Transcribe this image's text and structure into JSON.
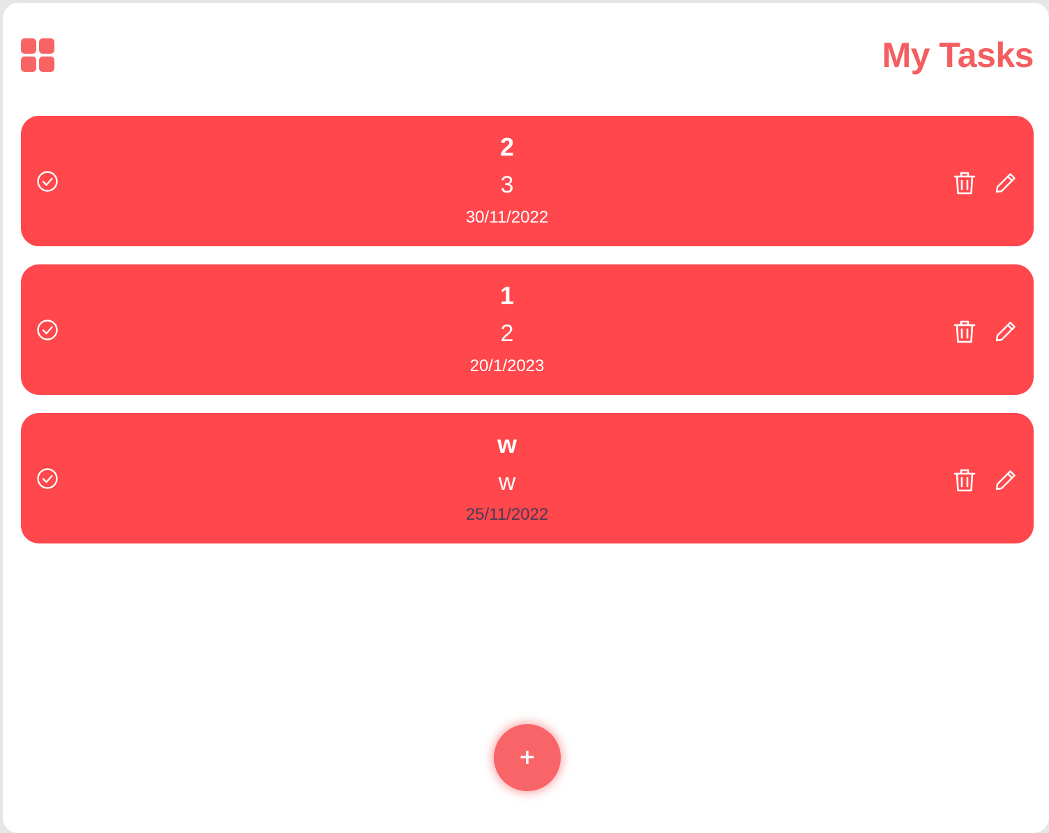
{
  "header": {
    "title": "My Tasks",
    "menu_icon": "grid-icon"
  },
  "tasks": [
    {
      "title": "2",
      "description": "3",
      "date": "30/11/2022",
      "date_color": "#ffffff"
    },
    {
      "title": "1",
      "description": "2",
      "date": "20/1/2023",
      "date_color": "#ffffff"
    },
    {
      "title": "w",
      "description": "w",
      "date": "25/11/2022",
      "date_color": "#4a3a55"
    }
  ],
  "task_actions": {
    "complete_icon": "check-circle-icon",
    "delete_icon": "trash-icon",
    "edit_icon": "pencil-icon"
  },
  "add_button": {
    "label": "+"
  },
  "colors": {
    "accent": "#f35e61",
    "card": "#ff474c",
    "fab": "#f86468",
    "background": "#ffffff"
  }
}
